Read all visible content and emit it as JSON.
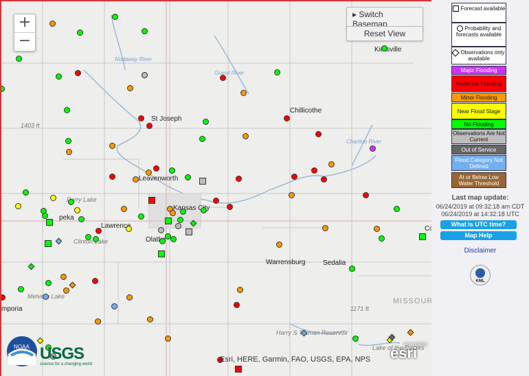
{
  "map": {
    "zoom_in": "+",
    "zoom_out": "−",
    "switch_basemap": "Switch Basemap",
    "reset_view": "Reset View",
    "attribution": "Esri, HERE, Garmin, FAO, USGS, EPA, NPS",
    "esri_logo": "esri",
    "esri_powered": "POWERED BY",
    "noaa_logo": "NOAA",
    "usgs_logo": "USGS",
    "usgs_tagline": "science for a changing world",
    "places": {
      "st_joseph": "St Joseph",
      "leavenworth": "Leavenworth",
      "kansas_city": "Kansas City",
      "lawrence": "Lawrence",
      "olathe": "Olathe",
      "chillicothe": "Chillicothe",
      "kirksville": "Kirksville",
      "warrensburg": "Warrensburg",
      "sedalia": "Sedalia",
      "perry_lake": "Perry Lake",
      "clinton_lake": "Clinton Lake",
      "melvern_lake": "Melvern Lake",
      "emporia": "mporia",
      "topeka": "peka",
      "missouri": "MISSOURI",
      "harry_s": "Harry S Truman Reservoir",
      "lake_ozarks": "Lake of the Ozarks",
      "elev_1403": "1403 ft",
      "elev_1171": "1171 ft",
      "nodaway": "Nodaway River",
      "grand": "Grand River",
      "chariton": "Chariton River",
      "co": "Co"
    }
  },
  "legend": {
    "forecast": "Forecast available",
    "probability": "Probability and forecasts available",
    "observations": "Observations only available",
    "items": [
      {
        "label": "Major Flooding",
        "color": "#cc33ff"
      },
      {
        "label": "Moderate Flooding",
        "color": "#ff0000"
      },
      {
        "label": "Minor Flooding",
        "color": "#ff9900"
      },
      {
        "label": "Near Flood Stage",
        "color": "#ffff00"
      },
      {
        "label": "No Flooding",
        "color": "#00ff00"
      },
      {
        "label": "Observations Are Not Current",
        "color": "#bdbdbd"
      },
      {
        "label": "Out of Service",
        "color": "#666666"
      },
      {
        "label": "Flood Category Not Defined",
        "color": "#72aff0"
      },
      {
        "label": "At or Below Low Water Threshold",
        "color": "#996633"
      }
    ]
  },
  "update": {
    "title": "Last map update:",
    "cdt": "06/24/2019 at 09:32:18 am CDT",
    "utc": "06/24/2019 at 14:32:18 UTC",
    "utc_button": "What is UTC time?",
    "help_button": "Map Help",
    "disclaimer": "Disclaimer",
    "kml": "KML"
  }
}
